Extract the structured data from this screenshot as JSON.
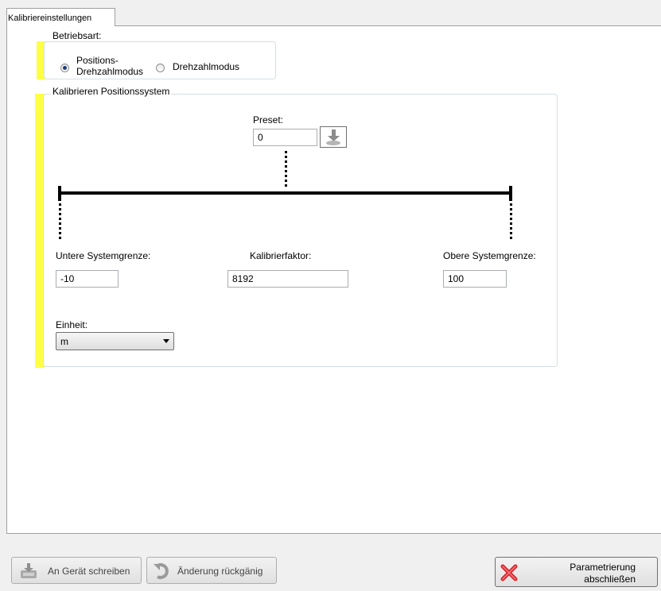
{
  "tab": {
    "label": "Kalibriereinstellungen"
  },
  "betriebsart": {
    "legend": "Betriebsart:",
    "option1_line1": "Positions-",
    "option1_line2": "Drehzahlmodus",
    "option2": "Drehzahlmodus",
    "selected": "Positions-Drehzahlmodus"
  },
  "kalibrieren": {
    "legend": "Kalibrieren Positionssystem",
    "preset_label": "Preset:",
    "preset_value": "0",
    "untere_label": "Untere Systemgrenze:",
    "untere_value": "-10",
    "faktor_label": "Kalibrierfaktor:",
    "faktor_value": "8192",
    "obere_label": "Obere Systemgrenze:",
    "obere_value": "100",
    "einheit_label": "Einheit:",
    "einheit_value": "m"
  },
  "footer": {
    "write_label": "An Gerät schreiben",
    "undo_label": "Änderung rückgänig",
    "finish_line1": "Parametrierung",
    "finish_line2": "abschließen"
  },
  "colors": {
    "required_bar": "#ffff44",
    "cancel_icon": "#d9262c"
  }
}
